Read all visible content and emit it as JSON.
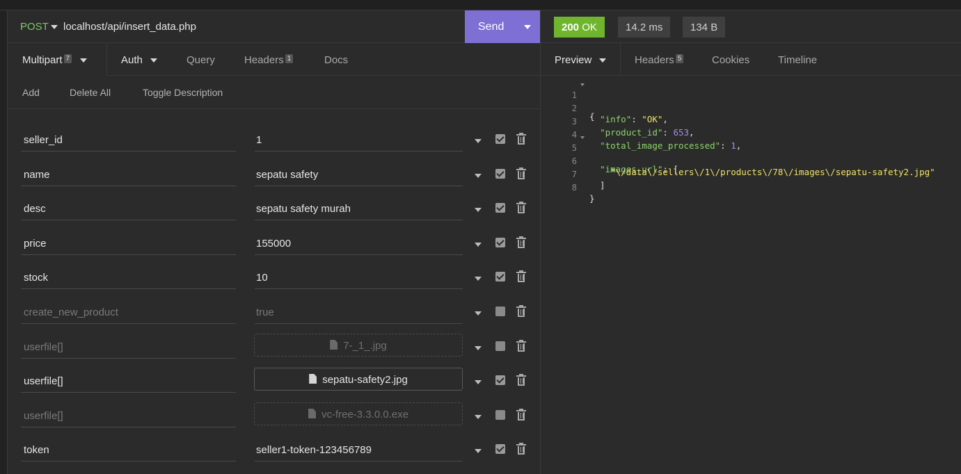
{
  "request": {
    "method": "POST",
    "url": "localhost/api/insert_data.php",
    "send_label": "Send",
    "tabs": [
      {
        "label": "Multipart",
        "badge": "7"
      },
      {
        "label": "Auth"
      },
      {
        "label": "Query"
      },
      {
        "label": "Headers",
        "badge": "1"
      },
      {
        "label": "Docs"
      }
    ],
    "actions": [
      "Add",
      "Delete All",
      "Toggle Description"
    ],
    "params": [
      {
        "name": "seller_id",
        "value": "1",
        "enabled": true
      },
      {
        "name": "name",
        "value": "sepatu safety",
        "enabled": true
      },
      {
        "name": "desc",
        "value": "sepatu safety murah",
        "enabled": true
      },
      {
        "name": "price",
        "value": "155000",
        "enabled": true
      },
      {
        "name": "stock",
        "value": "10",
        "enabled": true
      },
      {
        "name": "create_new_product",
        "value": "true",
        "enabled": false
      },
      {
        "name": "userfile[]",
        "file": "7-_1_.jpg",
        "enabled": false
      },
      {
        "name": "userfile[]",
        "file": "sepatu-safety2.jpg",
        "enabled": true
      },
      {
        "name": "userfile[]",
        "file": "vc-free-3.3.0.0.exe",
        "enabled": false
      },
      {
        "name": "token",
        "value": "seller1-token-123456789",
        "enabled": true
      }
    ]
  },
  "response": {
    "status_code": "200",
    "status_text": "OK",
    "time": "14.2 ms",
    "size": "134 B",
    "tabs": [
      {
        "label": "Preview"
      },
      {
        "label": "Headers",
        "badge": "5"
      },
      {
        "label": "Cookies"
      },
      {
        "label": "Timeline"
      }
    ],
    "body_lines": [
      {
        "n": "1",
        "fold": true
      },
      {
        "n": "2"
      },
      {
        "n": "3"
      },
      {
        "n": "4"
      },
      {
        "n": "5",
        "fold": true
      },
      {
        "n": "6"
      },
      {
        "n": "7"
      },
      {
        "n": "8"
      }
    ],
    "json": {
      "info_key": "\"info\"",
      "info_val": "\"OK\"",
      "pid_key": "\"product_id\"",
      "pid_val": "653",
      "tip_key": "\"total_image_processed\"",
      "tip_val": "1",
      "imgs_key": "\"images_url\"",
      "img0": "\"\\/data\\/sellers\\/1\\/products\\/78\\/images\\/sepatu-safety2.jpg\""
    }
  }
}
